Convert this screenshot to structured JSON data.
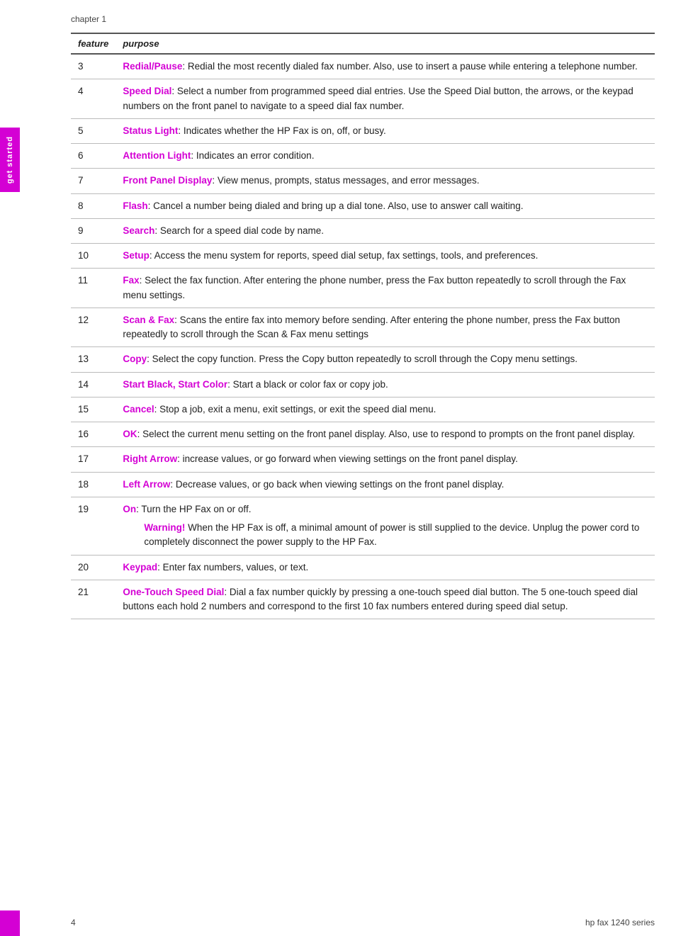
{
  "sidetab": {
    "label": "get started"
  },
  "chapter": "chapter 1",
  "table": {
    "headers": [
      "feature",
      "purpose"
    ],
    "rows": [
      {
        "feature": "3",
        "highlight": "Redial/Pause",
        "text": ": Redial the most recently dialed fax number. Also, use to insert a pause while entering a telephone number."
      },
      {
        "feature": "4",
        "highlight": "Speed Dial",
        "text": ": Select a number from programmed speed dial entries. Use the Speed Dial button, the arrows, or the keypad numbers on the front panel to navigate to a speed dial fax number."
      },
      {
        "feature": "5",
        "highlight": "Status Light",
        "text": ": Indicates whether the HP Fax is on, off, or busy."
      },
      {
        "feature": "6",
        "highlight": "Attention Light",
        "text": ": Indicates an error condition."
      },
      {
        "feature": "7",
        "highlight": "Front Panel Display",
        "text": ": View menus, prompts, status messages, and error messages."
      },
      {
        "feature": "8",
        "highlight": "Flash",
        "text": ": Cancel a number being dialed and bring up a dial tone. Also, use to answer call waiting."
      },
      {
        "feature": "9",
        "highlight": "Search",
        "text": ": Search for a speed dial code by name."
      },
      {
        "feature": "10",
        "highlight": "Setup",
        "text": ": Access the menu system for reports, speed dial setup, fax settings, tools, and preferences."
      },
      {
        "feature": "11",
        "highlight": "Fax",
        "text": ": Select the fax function. After entering the phone number, press the Fax button repeatedly to scroll through the Fax menu settings."
      },
      {
        "feature": "12",
        "highlight": "Scan & Fax",
        "text": ": Scans the entire fax into memory before sending. After entering the phone number, press the Fax button repeatedly to scroll through the Scan & Fax menu settings"
      },
      {
        "feature": "13",
        "highlight": "Copy",
        "text": ": Select the copy function. Press the Copy button repeatedly to scroll through the Copy menu settings."
      },
      {
        "feature": "14",
        "highlight": "Start Black, Start Color",
        "text": ": Start a black or color fax or copy job."
      },
      {
        "feature": "15",
        "highlight": "Cancel",
        "text": ": Stop a job, exit a menu, exit settings, or exit the speed dial menu."
      },
      {
        "feature": "16",
        "highlight": "OK",
        "text": ": Select the current menu setting on the front panel display. Also, use to respond to prompts on the front panel display."
      },
      {
        "feature": "17",
        "highlight": "Right Arrow",
        "text": ": increase values, or go forward when viewing settings on the front panel display."
      },
      {
        "feature": "18",
        "highlight": "Left Arrow",
        "text": ": Decrease values, or go back when viewing settings on the front panel display."
      },
      {
        "feature": "19",
        "highlight": "On",
        "text": ": Turn the HP Fax on or off.",
        "warning": {
          "label": "Warning!",
          "text": " When the HP Fax is off, a minimal amount of power is still supplied to the device. Unplug the power cord to completely disconnect the power supply to the HP Fax."
        }
      },
      {
        "feature": "20",
        "highlight": "Keypad",
        "text": ": Enter fax numbers, values, or text."
      },
      {
        "feature": "21",
        "highlight": "One-Touch Speed Dial",
        "text": ": Dial a fax number quickly by pressing a one-touch speed dial button. The 5 one-touch speed dial buttons each hold 2 numbers and correspond to the first 10 fax numbers entered during speed dial setup."
      }
    ]
  },
  "footer": {
    "page_number": "4",
    "product": "hp fax 1240 series"
  }
}
